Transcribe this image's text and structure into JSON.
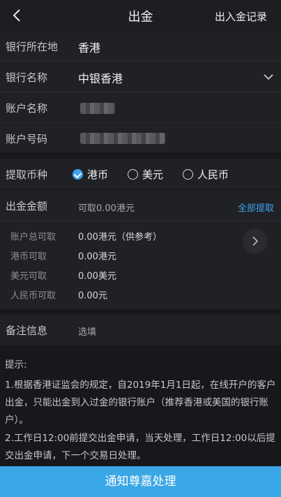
{
  "header": {
    "title": "出金",
    "records_link": "出入金记录"
  },
  "bank_info": {
    "location_label": "银行所在地",
    "location_value": "香港",
    "bank_name_label": "银行名称",
    "bank_name_value": "中银香港",
    "account_name_label": "账户名称",
    "account_number_label": "账户号码"
  },
  "currency": {
    "label": "提取币种",
    "options": [
      "港币",
      "美元",
      "人民币"
    ],
    "selected": "港币"
  },
  "amount": {
    "label": "出金金额",
    "placeholder": "可取0.00港元",
    "withdraw_all": "全部提取"
  },
  "available": [
    {
      "label": "账户总可取",
      "value": "0.00港元（供参考）"
    },
    {
      "label": "港币可取",
      "value": "0.00港元"
    },
    {
      "label": "美元可取",
      "value": "0.00美元"
    },
    {
      "label": "人民币可取",
      "value": "0.00元"
    }
  ],
  "remarks": {
    "label": "备注信息",
    "placeholder": "选填"
  },
  "tips": {
    "title": "提示:",
    "line1": "1.根据香港证监会的规定，自2019年1月1日起，在线开户的客户出金，只能出金到入过金的银行账户（推荐香港或美国的银行账户）。",
    "line2": "2.工作日12:00前提交出金申请，当天处理，工作日12:00以后提交出金申请，下一个交易日处理。"
  },
  "submit_label": "通知尊嘉处理",
  "colors": {
    "accent": "#3ea3f0",
    "button": "#3aa7e6"
  }
}
